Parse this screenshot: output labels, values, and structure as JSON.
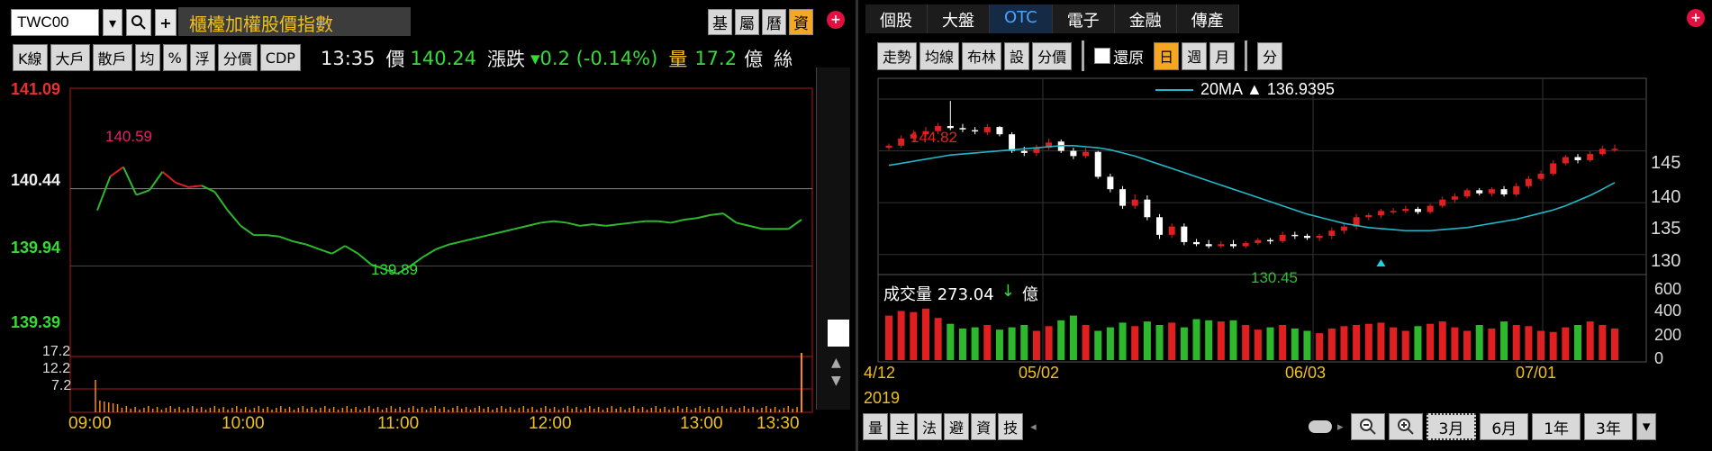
{
  "left": {
    "symbol": "TWC00",
    "name": "櫃檯加權股價指數",
    "top_tags": [
      "基",
      "屬",
      "曆",
      "資"
    ],
    "toolbar": [
      "K線",
      "大戶",
      "散戶",
      "均",
      "%",
      "浮",
      "分價",
      "CDP"
    ],
    "quote": {
      "time": "13:35",
      "price_label": "價",
      "price": "140.24",
      "change_label": "漲跌",
      "change": "▾0.2 (-0.14%)",
      "volume_label": "量",
      "volume": "17.2",
      "volume_unit": "億",
      "extra": "絲"
    },
    "price_axis": [
      "141.09",
      "140.44",
      "139.94",
      "139.39"
    ],
    "volume_axis": [
      "17.2",
      "12.2",
      "7.2"
    ],
    "high_label": "140.59",
    "low_label": "139.89",
    "time_axis": [
      "09:00",
      "10:00",
      "11:00",
      "12:00",
      "13:00",
      "13:30"
    ],
    "colors": {
      "up": "#e02020",
      "down": "#2db82d",
      "volume": "#ff8a00"
    }
  },
  "right": {
    "tabs": [
      "個股",
      "大盤",
      "OTC",
      "電子",
      "金融",
      "傳產"
    ],
    "active_tab": "OTC",
    "toolbar": [
      "走勢",
      "均線",
      "布林",
      "設",
      "分價"
    ],
    "restore_label": "還原",
    "periods": [
      "日",
      "週",
      "月"
    ],
    "active_period": "日",
    "min_button": "分",
    "legend": "20MA ▲ 136.9395",
    "high_label": "144.82",
    "low_label": "130.45",
    "price_axis": [
      "145",
      "140",
      "135",
      "130"
    ],
    "volume_title": "成交量 273.04",
    "volume_arrow": "↓",
    "volume_unit": "億",
    "volume_axis": [
      "600",
      "400",
      "200",
      "0"
    ],
    "date_axis": [
      "4/12",
      "05/02",
      "06/03",
      "07/01"
    ],
    "year_label": "2019",
    "bottom_buttons": [
      "量",
      "主",
      "法",
      "避",
      "資",
      "技"
    ],
    "ranges": [
      "3月",
      "6月",
      "1年",
      "3年"
    ],
    "selected_range": "3月"
  },
  "chart_data": [
    {
      "type": "line",
      "title": "櫃檯加權股價指數",
      "xlabel": "",
      "ylabel": "",
      "x": [
        "09:00",
        "09:05",
        "09:10",
        "09:15",
        "09:20",
        "09:25",
        "09:30",
        "09:35",
        "09:40",
        "09:45",
        "09:50",
        "09:55",
        "10:00",
        "10:05",
        "10:10",
        "10:15",
        "10:20",
        "10:25",
        "10:30",
        "10:35",
        "10:40",
        "10:45",
        "10:50",
        "10:55",
        "11:00",
        "11:05",
        "11:10",
        "11:15",
        "11:20",
        "11:25",
        "11:30",
        "11:35",
        "11:40",
        "11:45",
        "11:50",
        "11:55",
        "12:00",
        "12:05",
        "12:10",
        "12:15",
        "12:20",
        "12:25",
        "12:30",
        "12:35",
        "12:40",
        "12:45",
        "12:50",
        "12:55",
        "13:00",
        "13:05",
        "13:10",
        "13:15",
        "13:20",
        "13:25",
        "13:30"
      ],
      "values": [
        140.3,
        140.52,
        140.58,
        140.4,
        140.43,
        140.55,
        140.48,
        140.45,
        140.46,
        140.42,
        140.3,
        140.2,
        140.14,
        140.14,
        140.13,
        140.1,
        140.08,
        140.05,
        140.02,
        140.07,
        140.02,
        139.95,
        139.92,
        139.89,
        139.94,
        140.0,
        140.05,
        140.08,
        140.1,
        140.12,
        140.14,
        140.16,
        140.18,
        140.2,
        140.22,
        140.23,
        140.22,
        140.2,
        140.21,
        140.2,
        140.21,
        140.22,
        140.23,
        140.23,
        140.22,
        140.24,
        140.25,
        140.27,
        140.28,
        140.22,
        140.2,
        140.18,
        140.18,
        140.18,
        140.24
      ],
      "ylim": [
        139.39,
        141.09
      ],
      "reference": 140.44,
      "volume_ylim": [
        0,
        17.2
      ]
    },
    {
      "type": "bar",
      "title": "",
      "xlabel": "",
      "ylabel": "",
      "categories": [
        "4/12",
        "4/15",
        "4/16",
        "4/17",
        "4/18",
        "4/19",
        "4/22",
        "4/23",
        "4/24",
        "4/25",
        "4/26",
        "4/29",
        "4/30",
        "5/02",
        "5/03",
        "5/06",
        "5/07",
        "5/08",
        "5/09",
        "5/10",
        "5/13",
        "5/14",
        "5/15",
        "5/16",
        "5/17",
        "5/20",
        "5/21",
        "5/22",
        "5/23",
        "5/24",
        "5/27",
        "5/28",
        "5/29",
        "5/30",
        "5/31",
        "6/03",
        "6/04",
        "6/05",
        "6/06",
        "6/10",
        "6/11",
        "6/12",
        "6/13",
        "6/14",
        "6/17",
        "6/18",
        "6/19",
        "6/20",
        "6/21",
        "6/24",
        "6/25",
        "6/26",
        "6/27",
        "6/28",
        "7/01",
        "7/02",
        "7/03",
        "7/04",
        "7/05",
        "7/08"
      ],
      "series": [
        {
          "name": "open",
          "values": [
            140.3,
            140.5,
            141.2,
            141.6,
            141.9,
            142.4,
            142.2,
            142.0,
            141.8,
            142.3,
            141.6,
            140.0,
            139.8,
            140.3,
            140.9,
            140.0,
            139.5,
            139.9,
            137.5,
            136.3,
            134.7,
            135.3,
            133.6,
            131.9,
            132.7,
            131.2,
            131.0,
            130.8,
            131.0,
            130.8,
            131.1,
            131.4,
            131.3,
            131.9,
            131.8,
            131.6,
            131.8,
            132.3,
            132.7,
            133.6,
            133.8,
            134.2,
            134.2,
            134.4,
            134.1,
            134.7,
            135.3,
            135.6,
            136.2,
            135.9,
            136.3,
            135.8,
            136.6,
            137.3,
            137.8,
            138.8,
            139.4,
            139.1,
            139.7,
            140.2
          ]
        },
        {
          "name": "close",
          "values": [
            140.5,
            141.2,
            141.6,
            141.9,
            142.4,
            142.2,
            142.1,
            141.9,
            142.3,
            141.6,
            140.0,
            139.8,
            140.3,
            140.8,
            140.0,
            139.5,
            139.9,
            137.5,
            136.3,
            134.7,
            135.3,
            133.6,
            131.9,
            132.7,
            131.2,
            131.0,
            130.8,
            131.0,
            130.8,
            131.1,
            131.4,
            131.3,
            131.9,
            131.8,
            131.6,
            131.8,
            132.3,
            132.7,
            133.6,
            133.8,
            134.2,
            134.2,
            134.4,
            134.1,
            134.7,
            135.3,
            135.6,
            136.2,
            135.9,
            136.3,
            135.8,
            136.6,
            137.3,
            137.8,
            138.8,
            139.4,
            139.1,
            139.7,
            140.2,
            140.2
          ]
        },
        {
          "name": "high",
          "values": [
            140.7,
            141.5,
            142.0,
            142.3,
            142.7,
            144.82,
            142.6,
            142.3,
            142.6,
            142.4,
            141.8,
            140.4,
            140.6,
            141.2,
            141.1,
            140.3,
            140.3,
            140.0,
            137.8,
            136.6,
            135.8,
            135.7,
            133.9,
            133.0,
            133.0,
            131.5,
            131.4,
            131.3,
            131.4,
            131.3,
            131.6,
            131.6,
            132.2,
            132.2,
            132.0,
            132.0,
            132.6,
            133.0,
            133.9,
            134.0,
            134.4,
            134.5,
            134.7,
            134.6,
            134.9,
            135.6,
            135.9,
            136.4,
            136.4,
            136.5,
            136.6,
            136.9,
            137.6,
            138.1,
            139.1,
            139.6,
            139.7,
            140.0,
            140.5,
            140.6
          ]
        },
        {
          "name": "low",
          "values": [
            140.1,
            140.3,
            140.9,
            141.3,
            141.6,
            142.0,
            141.8,
            141.6,
            141.5,
            141.4,
            139.8,
            139.5,
            139.5,
            140.1,
            139.8,
            139.2,
            139.3,
            137.3,
            136.0,
            134.4,
            134.4,
            133.3,
            131.5,
            131.6,
            130.9,
            130.8,
            130.6,
            130.6,
            130.6,
            130.6,
            130.9,
            131.0,
            131.1,
            131.5,
            131.4,
            131.3,
            131.5,
            132.0,
            132.4,
            133.3,
            133.5,
            133.9,
            134.0,
            133.9,
            133.9,
            134.5,
            135.0,
            135.4,
            135.7,
            135.6,
            135.6,
            135.6,
            136.4,
            137.1,
            137.6,
            138.6,
            138.8,
            138.9,
            139.5,
            139.9
          ]
        },
        {
          "name": "volume",
          "values": [
            380,
            420,
            410,
            440,
            360,
            310,
            270,
            280,
            300,
            260,
            280,
            300,
            250,
            290,
            340,
            380,
            300,
            250,
            280,
            320,
            290,
            330,
            300,
            320,
            280,
            350,
            340,
            330,
            340,
            300,
            260,
            280,
            300,
            270,
            250,
            230,
            270,
            290,
            300,
            310,
            320,
            280,
            250,
            290,
            310,
            330,
            280,
            250,
            300,
            270,
            330,
            300,
            290,
            250,
            240,
            280,
            300,
            330,
            300,
            270
          ]
        },
        {
          "name": "20MA",
          "values": [
            138.6,
            138.8,
            139.0,
            139.2,
            139.4,
            139.6,
            139.7,
            139.8,
            139.9,
            140.0,
            140.1,
            140.2,
            140.3,
            140.4,
            140.5,
            140.5,
            140.4,
            140.3,
            140.1,
            139.8,
            139.5,
            139.1,
            138.7,
            138.3,
            137.9,
            137.5,
            137.1,
            136.7,
            136.3,
            135.9,
            135.5,
            135.1,
            134.7,
            134.3,
            133.9,
            133.6,
            133.3,
            133.0,
            132.8,
            132.6,
            132.5,
            132.4,
            132.3,
            132.3,
            132.3,
            132.4,
            132.5,
            132.6,
            132.8,
            133.0,
            133.2,
            133.4,
            133.7,
            134.0,
            134.3,
            134.7,
            135.2,
            135.7,
            136.3,
            136.94
          ]
        }
      ],
      "ylim": [
        128.5,
        147
      ],
      "volume_ylim": [
        0,
        600
      ]
    }
  ]
}
